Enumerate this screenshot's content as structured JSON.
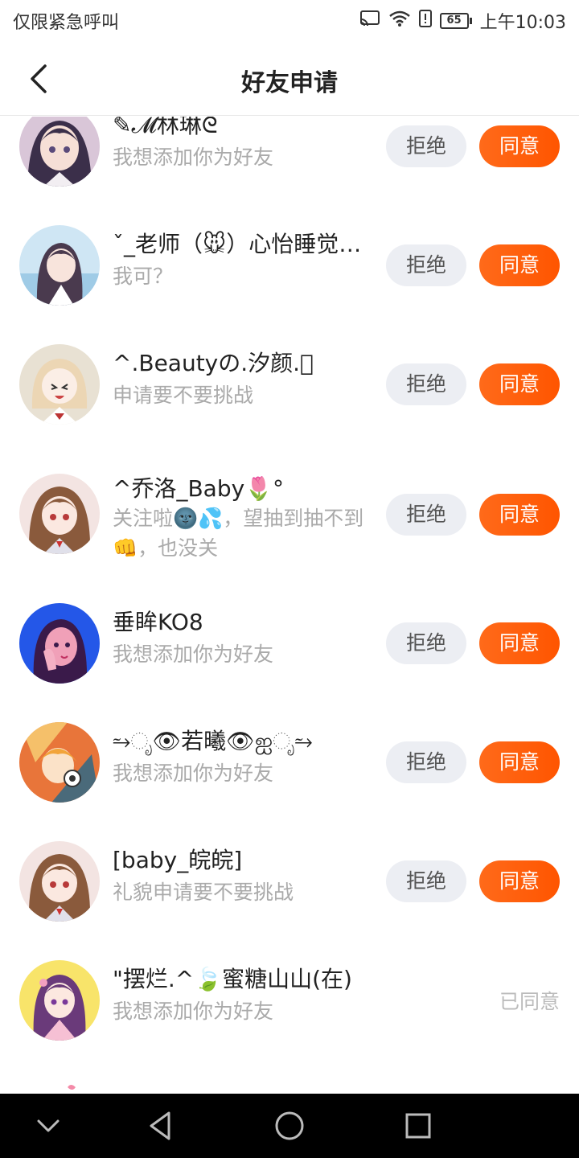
{
  "status_bar": {
    "carrier": "仅限紧急呼叫",
    "battery": "65",
    "time": "上午10:03"
  },
  "header": {
    "title": "好友申请"
  },
  "buttons": {
    "reject": "拒绝",
    "accept": "同意"
  },
  "requests": [
    {
      "name": "✎𝓜林琳ᘓ",
      "message": "我想添加你为好友",
      "status": "pending"
    },
    {
      "name": "ˇ_老师（🐭）心怡睡觉…",
      "message": "我可？",
      "status": "pending"
    },
    {
      "name": "^.Beautyの.汐颜.⃟",
      "message": "申请要不要挑战",
      "status": "pending"
    },
    {
      "name": "^乔洛_Baby🌷°",
      "message": "关注啦🌚💦，望抽到抽不到👊，也没关",
      "status": "pending"
    },
    {
      "name": "垂眸KO8",
      "message": "我想添加你为好友",
      "status": "pending"
    },
    {
      "name": "⥲ೃ👁若曦👁ஐೃ⥲",
      "message": "我想添加你为好友",
      "status": "pending"
    },
    {
      "name": "[baby_皖皖]",
      "message": "礼貌申请要不要挑战",
      "status": "pending"
    },
    {
      "name": "\"摆烂.^🍃蜜糖山山(在)",
      "message": "我想添加你为好友",
      "status": "accepted",
      "status_label": "已同意"
    }
  ],
  "colors": {
    "accent": "#ff5a0a",
    "reject_bg": "#eceef3",
    "secondary_text": "#aaaaaa"
  }
}
